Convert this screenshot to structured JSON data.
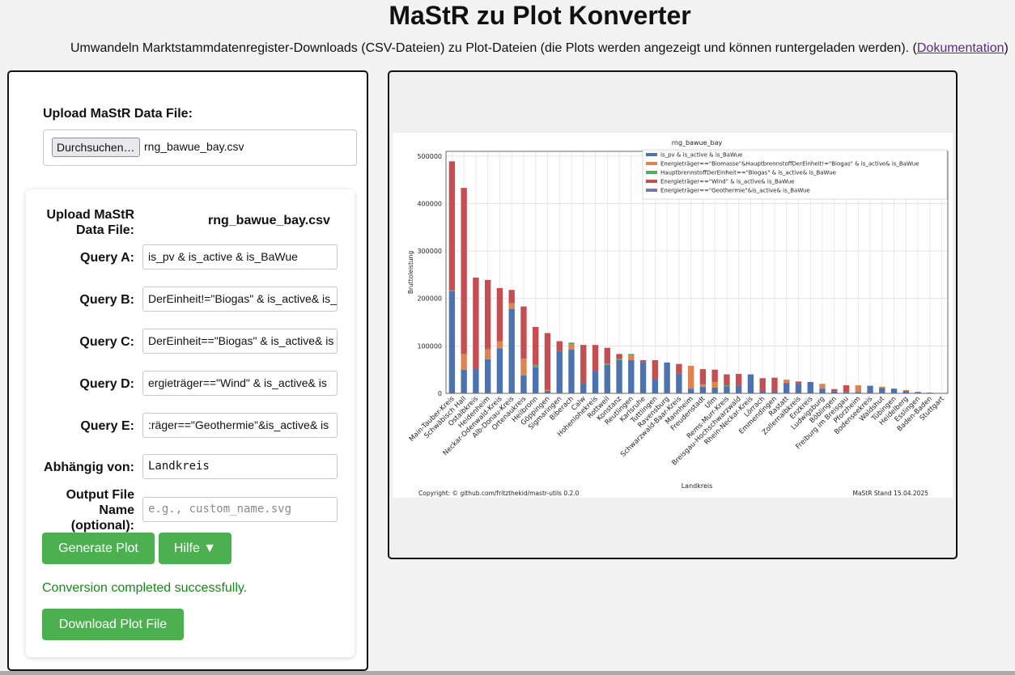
{
  "header": {
    "title": "MaStR zu Plot Konverter",
    "subtitle": "Umwandeln Marktstammdatenregister-Downloads (CSV-Dateien) zu Plot-Dateien (die Plots werden angezeigt und können runtergeladen werden). (",
    "doc_link": "Dokumentation",
    "subtitle_end": ")"
  },
  "upload": {
    "label": "Upload MaStR Data File:",
    "browse_button": "Durchsuchen…",
    "file_name": "rng_bawue_bay.csv"
  },
  "form": {
    "upload_label": "Upload MaStR Data File:",
    "upload_value": "rng_bawue_bay.csv",
    "query_a_label": "Query A:",
    "query_a_value": "is_pv & is_active & is_BaWue",
    "query_b_label": "Query B:",
    "query_b_value": "DerEinheit!=\"Biogas\" & is_active& is_",
    "query_c_label": "Query C:",
    "query_c_value": "DerEinheit==\"Biogas\" & is_active& is",
    "query_d_label": "Query D:",
    "query_d_value": "ergieträger==\"Wind\" & is_active& is",
    "query_e_label": "Query E:",
    "query_e_value": ":räger==\"Geothermie\"&is_active& is",
    "depends_label": "Abhängig von:",
    "depends_value": "Landkreis",
    "output_label": "Output File Name (optional):",
    "output_placeholder": "e.g., custom_name.svg",
    "generate_button": "Generate Plot",
    "help_button": "Hilfe ▼",
    "status": "Conversion completed successfully.",
    "download_button": "Download Plot File"
  },
  "chart_data": {
    "type": "bar",
    "stacked": true,
    "title": "rng_bawue_bay",
    "xlabel": "Landkreis",
    "ylabel": "Bruttoleistung",
    "ylim": [
      0,
      510000
    ],
    "yticks": [
      0,
      100000,
      200000,
      300000,
      400000,
      500000
    ],
    "grid": true,
    "legend_position": "top-right",
    "footer_left": "Copyright: © github.com/fritzthekid/mastr-utils 0.2.0",
    "footer_right": "MaStR Stand 15.04.2025",
    "categories": [
      "Main-Tauber-Kreis",
      "Schwäbisch Hall",
      "Ostalbkreis",
      "Heidenheim",
      "Neckar-Odenwald-Kreis",
      "Alb-Donau-Kreis",
      "Ortenaukreis",
      "Heilbronn",
      "Göppingen",
      "Sigmaringen",
      "Biberach",
      "Calw",
      "Hohenlohekreis",
      "Rottweil",
      "Konstanz",
      "Reutlingen",
      "Karlsruhe",
      "Tuttlingen",
      "Ravensburg",
      "Schwarzwald-Baar-Kreis",
      "Mannheim",
      "Freudenstadt",
      "Ulm",
      "Rems-Murr-Kreis",
      "Breisgau-Hochschwarzwald",
      "Rhein-Neckar-Kreis",
      "Lörrach",
      "Emmendingen",
      "Rastatt",
      "Zollernalbkreis",
      "Enzkreis",
      "Ludwigsburg",
      "Böblingen",
      "Freiburg im Breisgau",
      "Pforzheim",
      "Bodenseekreis",
      "Waldshut",
      "Tübingen",
      "Heidelberg",
      "Esslingen",
      "Baden-Baden",
      "Stuttgart"
    ],
    "series": [
      {
        "name": "is_pv & is_active & is_BaWue",
        "color": "#4c72b0",
        "values": [
          215000,
          50000,
          52000,
          72000,
          95000,
          178000,
          38000,
          55000,
          5000,
          90000,
          92000,
          22000,
          47000,
          60000,
          70000,
          70000,
          65000,
          30000,
          65000,
          42000,
          10000,
          14000,
          12000,
          15000,
          16000,
          40000,
          5000,
          5000,
          22000,
          20000,
          24000,
          10000,
          4000,
          3000,
          3000,
          16000,
          11000,
          10000,
          5000,
          3000,
          1500,
          500
        ]
      },
      {
        "name": "Energieträger==\"Biomasse\"&HauptbrennstoffDerEinheit!=\"Biogas\" & is_active& is_BaWue",
        "color": "#dd8452",
        "values": [
          0,
          33000,
          0,
          20000,
          15000,
          12000,
          35000,
          0,
          2000,
          0,
          12000,
          0,
          0,
          0,
          0,
          10000,
          0,
          0,
          0,
          0,
          48000,
          5000,
          12000,
          0,
          0,
          0,
          0,
          0,
          7000,
          0,
          0,
          10000,
          0,
          0,
          14000,
          0,
          3000,
          0,
          2000,
          0,
          0,
          0
        ]
      },
      {
        "name": "HauptbrennstoffDerEinheit==\"Biogas\" & is_active& is_BaWue",
        "color": "#55a868",
        "values": [
          2000,
          0,
          0,
          2000,
          0,
          0,
          0,
          5000,
          0,
          0,
          3000,
          0,
          0,
          3000,
          3000,
          3000,
          0,
          0,
          0,
          0,
          0,
          0,
          0,
          2000,
          0,
          0,
          0,
          0,
          0,
          0,
          0,
          0,
          0,
          0,
          0,
          0,
          0,
          0,
          0,
          0,
          0,
          0
        ]
      },
      {
        "name": "Energieträger==\"Wind\" & is_active& is_BaWue",
        "color": "#c44e52",
        "values": [
          272000,
          350000,
          192000,
          145000,
          112000,
          28000,
          110000,
          80000,
          120000,
          20000,
          0,
          80000,
          55000,
          33000,
          10000,
          0,
          5000,
          40000,
          0,
          20000,
          0,
          32000,
          26000,
          23000,
          25000,
          0,
          27000,
          28000,
          0,
          5000,
          0,
          0,
          5000,
          14000,
          0,
          0,
          0,
          0,
          0,
          0,
          0,
          0
        ]
      },
      {
        "name": "Energieträger==\"Geothermie\"&is_active& is_BaWue",
        "color": "#8172b3",
        "values": [
          0,
          0,
          0,
          0,
          0,
          0,
          0,
          0,
          0,
          0,
          0,
          0,
          0,
          0,
          0,
          0,
          0,
          0,
          0,
          0,
          0,
          0,
          0,
          0,
          0,
          0,
          0,
          0,
          0,
          0,
          0,
          0,
          0,
          0,
          0,
          0,
          0,
          0,
          0,
          0,
          0,
          0
        ]
      }
    ]
  }
}
